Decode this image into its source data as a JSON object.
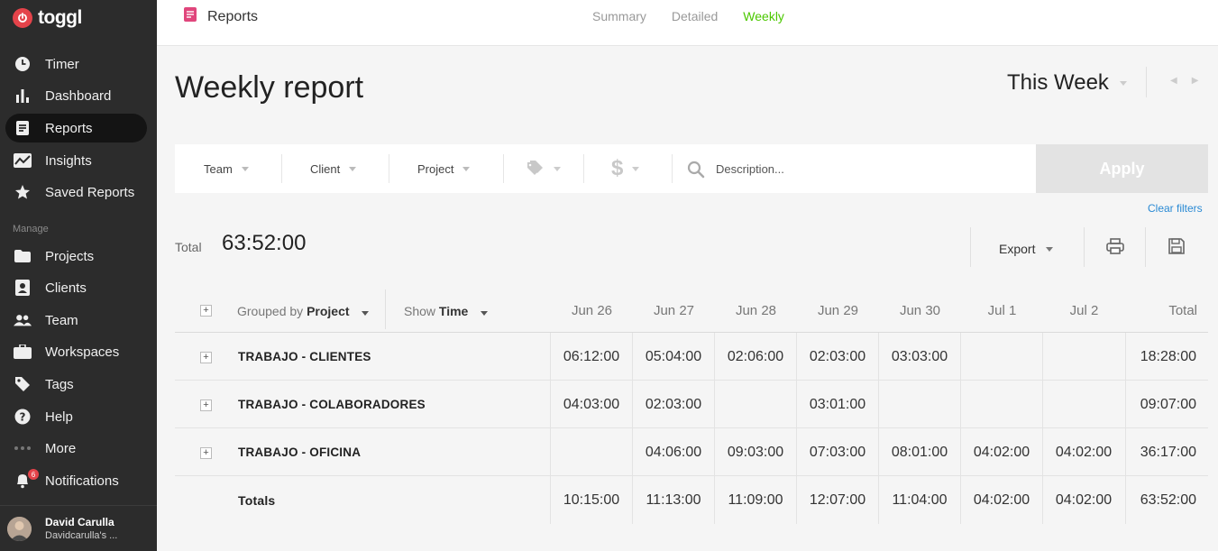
{
  "app": {
    "name": "toggl"
  },
  "sidebar": {
    "items": [
      {
        "label": "Timer",
        "icon": "clock-icon"
      },
      {
        "label": "Dashboard",
        "icon": "bar-chart-icon"
      },
      {
        "label": "Reports",
        "icon": "document-icon",
        "active": true
      },
      {
        "label": "Insights",
        "icon": "trend-icon"
      },
      {
        "label": "Saved Reports",
        "icon": "star-icon"
      }
    ],
    "manage_label": "Manage",
    "manage_items": [
      {
        "label": "Projects",
        "icon": "folder-icon"
      },
      {
        "label": "Clients",
        "icon": "client-icon"
      },
      {
        "label": "Team",
        "icon": "team-icon"
      },
      {
        "label": "Workspaces",
        "icon": "briefcase-icon"
      },
      {
        "label": "Tags",
        "icon": "tag-icon"
      },
      {
        "label": "Help",
        "icon": "help-icon"
      },
      {
        "label": "More",
        "icon": "more-dots-icon"
      },
      {
        "label": "Notifications",
        "icon": "bell-icon",
        "badge": "6"
      }
    ],
    "user": {
      "name": "David Carulla",
      "workspace": "Davidcarulla's ..."
    }
  },
  "header": {
    "title": "Reports",
    "tabs": [
      {
        "label": "Summary",
        "active": false
      },
      {
        "label": "Detailed",
        "active": false
      },
      {
        "label": "Weekly",
        "active": true
      }
    ]
  },
  "main": {
    "title": "Weekly report",
    "period": "This Week"
  },
  "filters": {
    "team": "Team",
    "client": "Client",
    "project": "Project",
    "search_placeholder": "Description...",
    "apply": "Apply",
    "clear": "Clear filters"
  },
  "summary": {
    "total_label": "Total",
    "total_value": "63:52:00",
    "export_label": "Export"
  },
  "table": {
    "group_prefix": "Grouped by",
    "group_value": "Project",
    "show_prefix": "Show",
    "show_value": "Time",
    "columns": [
      "Jun 26",
      "Jun 27",
      "Jun 28",
      "Jun 29",
      "Jun 30",
      "Jul 1",
      "Jul 2"
    ],
    "total_header": "Total",
    "rows": [
      {
        "name": "TRABAJO - CLIENTES",
        "values": [
          "06:12:00",
          "05:04:00",
          "02:06:00",
          "02:03:00",
          "03:03:00",
          "",
          ""
        ],
        "total": "18:28:00"
      },
      {
        "name": "TRABAJO - COLABORADORES",
        "values": [
          "04:03:00",
          "02:03:00",
          "",
          "03:01:00",
          "",
          "",
          ""
        ],
        "total": "09:07:00"
      },
      {
        "name": "TRABAJO - OFICINA",
        "values": [
          "",
          "04:06:00",
          "09:03:00",
          "07:03:00",
          "08:01:00",
          "04:02:00",
          "04:02:00"
        ],
        "total": "36:17:00"
      }
    ],
    "totals": {
      "name": "Totals",
      "values": [
        "10:15:00",
        "11:13:00",
        "11:09:00",
        "12:07:00",
        "11:04:00",
        "04:02:00",
        "04:02:00"
      ],
      "total": "63:52:00"
    }
  },
  "colors": {
    "accent_green": "#4bc800",
    "brand_red": "#e4434a",
    "sidebar_bg": "#2c2c2c",
    "link_blue": "#2a8ad4"
  }
}
